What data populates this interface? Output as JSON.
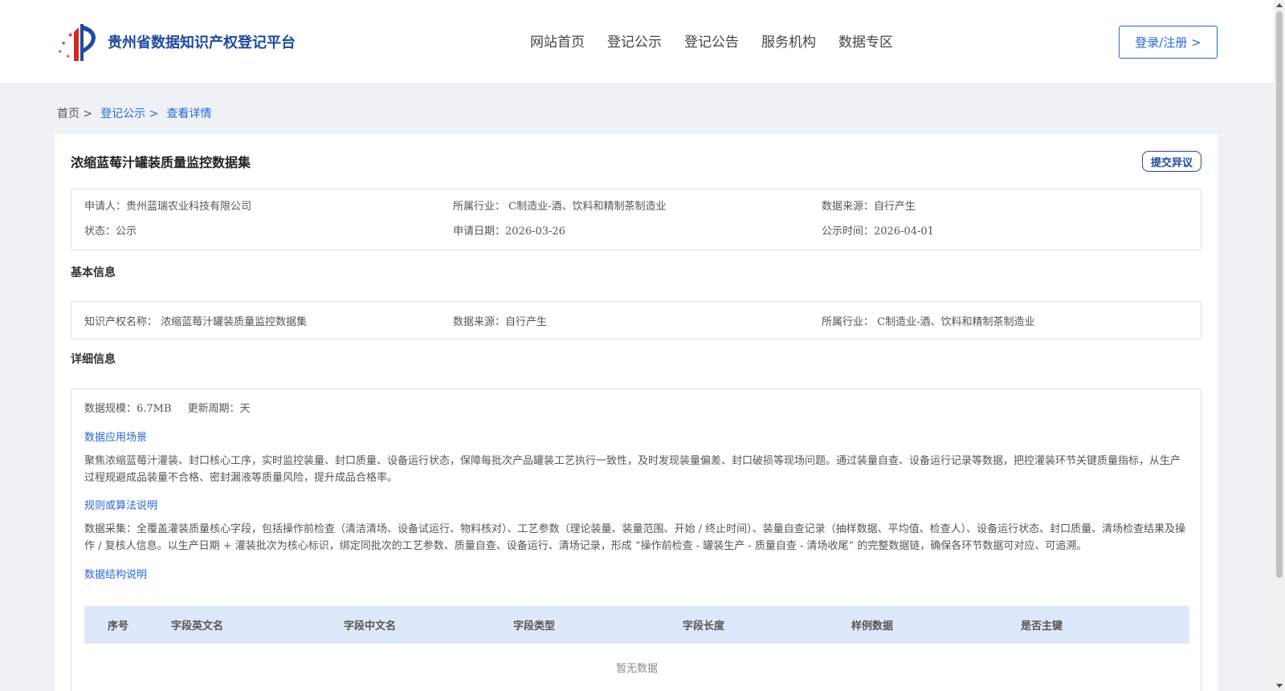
{
  "header": {
    "site_title": "贵州省数据知识产权登记平台",
    "nav": [
      "网站首页",
      "登记公示",
      "登记公告",
      "服务机构",
      "数据专区"
    ],
    "login_label": "登录/注册 >"
  },
  "breadcrumb": [
    "首页 >",
    "登记公示 >",
    "查看详情"
  ],
  "detail": {
    "title": "浓缩蓝莓汁罐装质量监控数据集",
    "dispute_label": "提交异议",
    "summary": {
      "applicant": "申请人：贵州蓝瑞农业科技有限公司",
      "industry": "所属行业： C制造业-酒、饮料和精制茶制造业",
      "source": "数据来源：自行产生",
      "status": "状态：公示",
      "apply_date": "申请日期：2026-03-26",
      "publish_date": "公示时间：2026-04-01"
    },
    "basic_heading": "基本信息",
    "basic": {
      "ip_name": "知识产权名称： 浓缩蓝莓汁罐装质量监控数据集",
      "source": "数据来源：自行产生",
      "industry": "所属行业： C制造业-酒、饮料和精制茶制造业"
    },
    "detail_heading": "详细信息",
    "scale": "数据规模：6.7MB",
    "cycle": "更新周期：天",
    "scenario_heading": "数据应用场景",
    "scenario_text": "聚焦浓缩蓝莓汁灌装、封口核心工序，实时监控装量、封口质量、设备运行状态，保障每批次产品罐装工艺执行一致性，及时发现装量偏差、封口破损等现场问题。通过装量自查、设备运行记录等数据，把控灌装环节关键质量指标，从生产过程规避成品装量不合格、密封漏液等质量风险，提升成品合格率。",
    "rules_heading": "规则或算法说明",
    "rules_text": "数据采集：全覆盖灌装质量核心字段，包括操作前检查（清洁清场、设备试运行、物料核对）、工艺参数（理论装量、装量范围、开始 / 终止时间）、装量自查记录（抽样数据、平均值、检查人）、设备运行状态、封口质量、清场检查结果及操作 / 复核人信息。以生产日期 + 灌装批次为核心标识，绑定同批次的工艺参数、质量自查、设备运行、清场记录，形成 “操作前检查 - 罐装生产 - 质量自查 - 清场收尾” 的完整数据链，确保各环节数据可对应、可追溯。",
    "structure_heading": "数据结构说明",
    "table_headers": [
      "序号",
      "字段英文名",
      "字段中文名",
      "字段类型",
      "字段长度",
      "样例数据",
      "是否主键"
    ],
    "table_empty": "暂无数据"
  },
  "colors": {
    "primary": "#2a67d8",
    "brand": "#1f4aa0",
    "table_header_bg": "#dde9fb",
    "page_bg": "#eef1f5"
  }
}
